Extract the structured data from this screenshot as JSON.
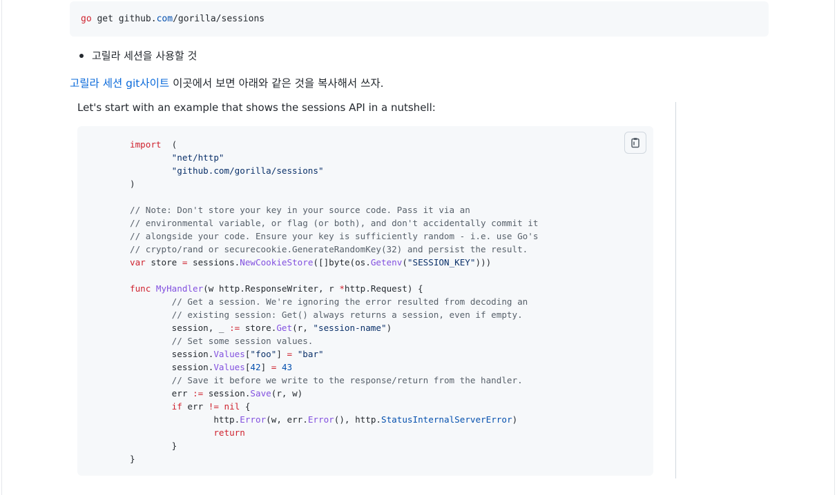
{
  "install_command": {
    "keyword": "go",
    "rest_prefix": " get github.",
    "com": "com",
    "rest_suffix": "/gorilla/sessions"
  },
  "bullet_text": "고릴라 세션을 사용할 것",
  "paragraph": {
    "link_text": "고릴라 세션 git사이트",
    "rest_text": " 이곳에서 보면 아래와 같은 것을 복사해서 쓰자."
  },
  "quote": {
    "intro_text": "Let's start with an example that shows the sessions API in a nutshell:"
  },
  "code_lines": [
    [
      [
        "kw",
        "import"
      ],
      [
        "",
        "  ("
      ]
    ],
    [
      [
        "",
        "        "
      ],
      [
        "st",
        "\"net/http\""
      ]
    ],
    [
      [
        "",
        "        "
      ],
      [
        "st",
        "\"github.com/gorilla/sessions\""
      ]
    ],
    [
      [
        "",
        ")"
      ]
    ],
    [
      [
        "",
        ""
      ]
    ],
    [
      [
        "cm",
        "// Note: Don't store your key in your source code. Pass it via an"
      ]
    ],
    [
      [
        "cm",
        "// environmental variable, or flag (or both), and don't accidentally commit it"
      ]
    ],
    [
      [
        "cm",
        "// alongside your code. Ensure your key is sufficiently random - i.e. use Go's"
      ]
    ],
    [
      [
        "cm",
        "// crypto/rand or securecookie.GenerateRandomKey(32) and persist the result."
      ]
    ],
    [
      [
        "kw",
        "var"
      ],
      [
        "",
        " store "
      ],
      [
        "kw",
        "="
      ],
      [
        "",
        " sessions."
      ],
      [
        "fn",
        "NewCookieStore"
      ],
      [
        "",
        "([]byte(os."
      ],
      [
        "fn",
        "Getenv"
      ],
      [
        "",
        "("
      ],
      [
        "st",
        "\"SESSION_KEY\""
      ],
      [
        "",
        ")))"
      ]
    ],
    [
      [
        "",
        ""
      ]
    ],
    [
      [
        "kw",
        "func"
      ],
      [
        "",
        ""
      ],
      [
        "fn",
        " MyHandler"
      ],
      [
        "",
        "(w http.ResponseWriter, r "
      ],
      [
        "kw",
        "*"
      ],
      [
        "",
        "http.Request) {"
      ]
    ],
    [
      [
        "",
        "        "
      ],
      [
        "cm",
        "// Get a session. We're ignoring the error resulted from decoding an"
      ]
    ],
    [
      [
        "",
        "        "
      ],
      [
        "cm",
        "// existing session: Get() always returns a session, even if empty."
      ]
    ],
    [
      [
        "",
        "        session, _ "
      ],
      [
        "kw",
        ":="
      ],
      [
        "",
        " store."
      ],
      [
        "fn",
        "Get"
      ],
      [
        "",
        "(r, "
      ],
      [
        "st",
        "\"session-name\""
      ],
      [
        "",
        ")"
      ]
    ],
    [
      [
        "",
        "        "
      ],
      [
        "cm",
        "// Set some session values."
      ]
    ],
    [
      [
        "",
        "        session."
      ],
      [
        "fn",
        "Values"
      ],
      [
        "",
        "["
      ],
      [
        "st",
        "\"foo\""
      ],
      [
        "",
        "] "
      ],
      [
        "kw",
        "="
      ],
      [
        "",
        " "
      ],
      [
        "st",
        "\"bar\""
      ]
    ],
    [
      [
        "",
        "        session."
      ],
      [
        "fn",
        "Values"
      ],
      [
        "",
        "["
      ],
      [
        "nu",
        "42"
      ],
      [
        "",
        "] "
      ],
      [
        "kw",
        "="
      ],
      [
        "",
        " "
      ],
      [
        "nu",
        "43"
      ]
    ],
    [
      [
        "",
        "        "
      ],
      [
        "cm",
        "// Save it before we write to the response/return from the handler."
      ]
    ],
    [
      [
        "",
        "        err "
      ],
      [
        "kw",
        ":="
      ],
      [
        "",
        " session."
      ],
      [
        "fn",
        "Save"
      ],
      [
        "",
        "(r, w)"
      ]
    ],
    [
      [
        "",
        "        "
      ],
      [
        "kw",
        "if"
      ],
      [
        "",
        " err "
      ],
      [
        "kw",
        "!="
      ],
      [
        "",
        " "
      ],
      [
        "kw",
        "nil"
      ],
      [
        "",
        " {"
      ]
    ],
    [
      [
        "",
        "                http."
      ],
      [
        "fn",
        "Error"
      ],
      [
        "",
        "(w, err."
      ],
      [
        "fn",
        "Error"
      ],
      [
        "",
        "(), http."
      ],
      [
        "bl",
        "StatusInternalServerError"
      ],
      [
        "",
        ")"
      ]
    ],
    [
      [
        "",
        "                "
      ],
      [
        "kw",
        "return"
      ]
    ],
    [
      [
        "",
        "        }"
      ]
    ],
    [
      [
        "",
        "}"
      ]
    ]
  ],
  "icons": {
    "copy": "clipboard-icon"
  },
  "colors": {
    "keyword": "#cf222e",
    "function": "#8250df",
    "comment": "#57606a",
    "string": "#0a3069",
    "link": "#0969da",
    "code_bg": "#f6f8fa"
  }
}
